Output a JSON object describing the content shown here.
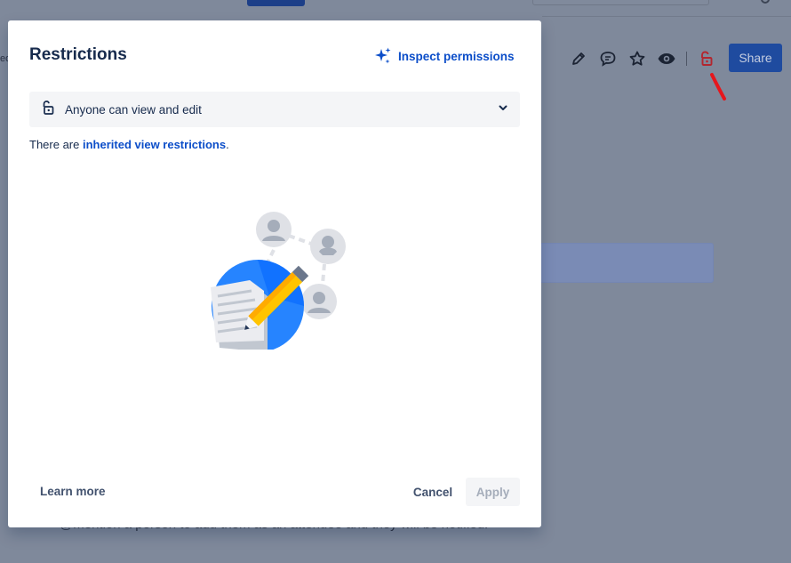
{
  "background": {
    "share_label": "Share",
    "edge_text": "ed",
    "bullet_text": "@mention a person to add them as an attendee and they will be notified.",
    "toolbar_icons": [
      "pencil-icon",
      "comment-icon",
      "star-icon",
      "eye-icon",
      "unlock-icon"
    ]
  },
  "modal": {
    "title": "Restrictions",
    "inspect_label": "Inspect permissions",
    "select": {
      "value": "Anyone can view and edit",
      "icon": "unlock-icon"
    },
    "inherited": {
      "prefix": "There are ",
      "link": "inherited view restrictions",
      "suffix": "."
    },
    "footer": {
      "learn_more": "Learn more",
      "cancel": "Cancel",
      "apply": "Apply"
    }
  },
  "colors": {
    "accent": "#0c4ec9",
    "overlay": "#7f899b",
    "share_button": "#1f4b9f",
    "restriction_icon": "#b3262f"
  }
}
